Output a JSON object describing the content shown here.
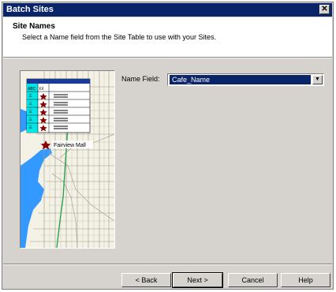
{
  "dialog": {
    "title": "Batch Sites",
    "close_glyph": "✕"
  },
  "header": {
    "title": "Site Names",
    "subtitle": "Select a Name field from the Site Table to use with your Sites."
  },
  "preview": {
    "table_headers": [
      "ABC",
      "XX"
    ],
    "map_label": "Fairview Mall"
  },
  "form": {
    "name_field_label": "Name Field:",
    "name_field_value": "Cafe_Name",
    "dropdown_glyph": "▼"
  },
  "buttons": {
    "back": "< Back",
    "next": "Next >",
    "cancel": "Cancel",
    "help": "Help"
  },
  "colors": {
    "title_bar": "#0a246a",
    "dialog_bg": "#d6d3ce",
    "water": "#3399ff",
    "table_cyan": "#00e5e5",
    "star": "#8b0000"
  }
}
